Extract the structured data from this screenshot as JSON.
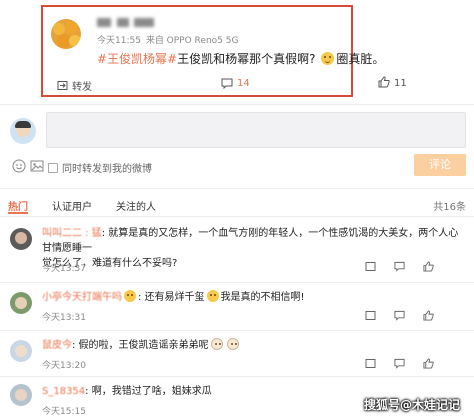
{
  "post": {
    "meta_time": "今天11:55",
    "meta_source": "来自 OPPO Reno5 5G",
    "tag": "#王俊凯杨幂#",
    "text": "王俊凯和杨幂那个真假啊?",
    "text_tail": "圈真脏。",
    "repost_label": "转发",
    "comment_count": "14",
    "like_count": "11"
  },
  "composer": {
    "repost_checkbox_label": "同时转发到我的微博",
    "submit_label": "评论"
  },
  "tabs": {
    "items": [
      "热门",
      "认证用户",
      "关注的人"
    ],
    "total": "共16条"
  },
  "comments": [
    {
      "name": "叫叫二二 : 猛",
      "text": ": 就算是真的又怎样，一个血气方刚的年轻人，一个性感饥渴的大美女，两个人心甘情愿睡一",
      "text2": "觉怎么了，难道有什么不妥吗?",
      "time": "今天13:37"
    },
    {
      "name": "小亭今天打端午吗",
      "text_after_emoji": ": 还有易烊千玺",
      "text_tail": "我是真的不相信啊!",
      "time": "今天13:31"
    },
    {
      "name": "鼠皮今",
      "text": ": 假的啦，王俊凯造谣亲弟弟呢",
      "time": "今天13:20"
    },
    {
      "name": "S_18354",
      "text": ": 啊，我错过了啥，姐妹求瓜",
      "time": "今天15:15"
    }
  ],
  "watermark": "搜狐号@木娃记记"
}
